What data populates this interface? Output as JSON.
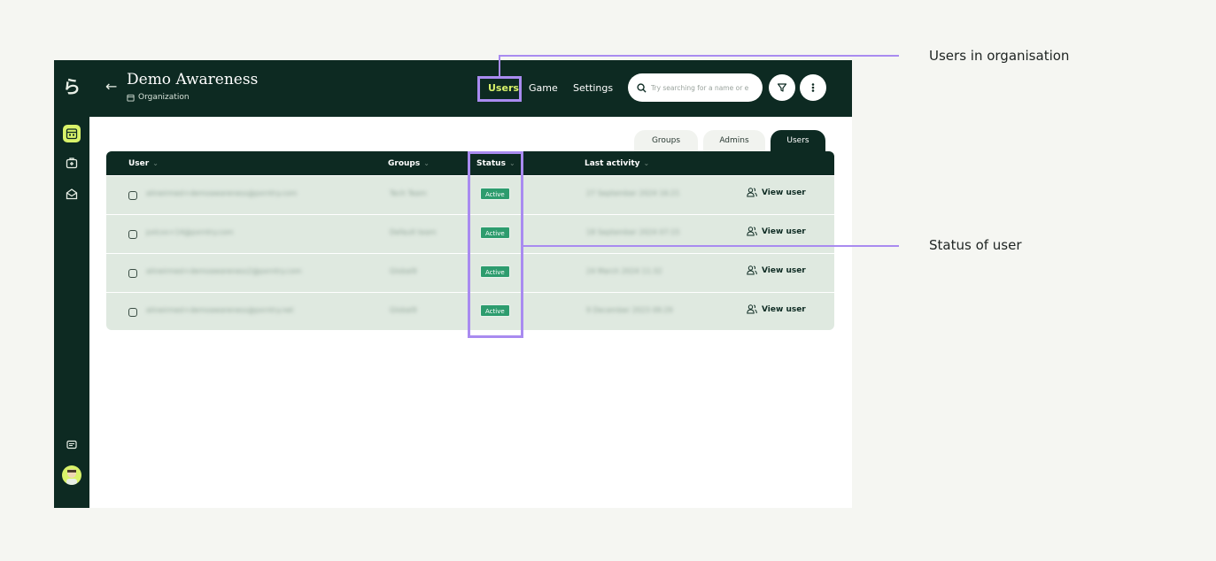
{
  "app": {
    "logo": "ら",
    "title": "Demo Awareness",
    "subtitle": "Organization",
    "back_icon": "arrow-left-icon"
  },
  "sidebar": {
    "items": [
      {
        "icon": "organization-icon",
        "active": true
      },
      {
        "icon": "briefcase-icon",
        "active": false
      },
      {
        "icon": "mail-icon",
        "active": false
      }
    ],
    "bottom": [
      {
        "icon": "chat-icon"
      },
      {
        "icon": "avatar"
      }
    ]
  },
  "nav": {
    "tabs": [
      {
        "label": "Users",
        "active": true
      },
      {
        "label": "Game",
        "active": false
      },
      {
        "label": "Settings",
        "active": false
      }
    ]
  },
  "search": {
    "placeholder": "Try searching for a name or e"
  },
  "toolbar": {
    "filter_icon": "filter-icon",
    "more_icon": "more-vertical-icon"
  },
  "panel_tabs": [
    {
      "label": "Groups",
      "active": false
    },
    {
      "label": "Admins",
      "active": false
    },
    {
      "label": "Users",
      "active": true
    }
  ],
  "table": {
    "columns": [
      "User",
      "Groups",
      "Status",
      "Last activity"
    ],
    "rows": [
      {
        "user": "alineirmed+demoawareness@pxrntry.com",
        "group": "Tech Team",
        "status": "Active",
        "last_activity": "27 September 2024 16:21",
        "action": "View user"
      },
      {
        "user": "pxlcxx+14@pxrntry.com",
        "group": "Default team",
        "status": "Active",
        "last_activity": "18 September 2024 07:15",
        "action": "View user"
      },
      {
        "user": "alineirmed+demoawareness2@pxrntry.com",
        "group": "Global9",
        "status": "Active",
        "last_activity": "24 March 2024 11:32",
        "action": "View user"
      },
      {
        "user": "alineirmed+demoawareness@pxrntry.net",
        "group": "Global9",
        "status": "Active",
        "last_activity": "9 December 2023 09:29",
        "action": "View user"
      }
    ]
  },
  "annotations": [
    {
      "label": "Users in organisation"
    },
    {
      "label": "Status of user"
    }
  ],
  "colors": {
    "dark": "#0d2a22",
    "accent": "#d9f26a",
    "highlight": "#a98bf0",
    "status_active": "#2d9c6e",
    "row_bg": "#dfe9e0"
  }
}
